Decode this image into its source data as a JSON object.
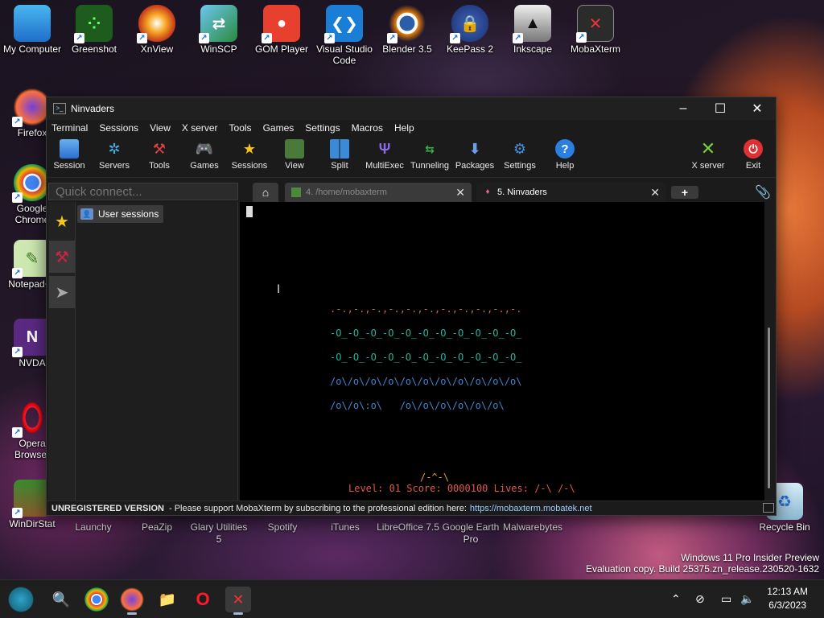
{
  "desktop": {
    "top_icons": [
      "My Computer",
      "Greenshot",
      "XnView",
      "WinSCP",
      "GOM Player",
      "Visual Studio Code",
      "Blender 3.5",
      "KeePass 2",
      "Inkscape",
      "MobaXterm"
    ],
    "left_icons": [
      "Firefox",
      "Google Chrome",
      "Notepad++",
      "NVDA",
      "Opera Browser",
      "WinDirStat"
    ],
    "bottom_icons": [
      "Launchy",
      "PeaZip",
      "Glary Utilities 5",
      "Spotify",
      "iTunes",
      "LibreOffice 7.5",
      "Google Earth Pro",
      "Malwarebytes",
      "Recycle Bin"
    ],
    "watermark": {
      "line1": "Windows 11 Pro Insider Preview",
      "line2": "Evaluation copy. Build 25375.zn_release.230520-1632"
    }
  },
  "window": {
    "title": "Ninvaders",
    "menu": [
      "Terminal",
      "Sessions",
      "View",
      "X server",
      "Tools",
      "Games",
      "Settings",
      "Macros",
      "Help"
    ],
    "toolbar": {
      "session": "Session",
      "servers": "Servers",
      "tools": "Tools",
      "games": "Games",
      "sessions": "Sessions",
      "view": "View",
      "split": "Split",
      "multiexec": "MultiExec",
      "tunneling": "Tunneling",
      "packages": "Packages",
      "settings": "Settings",
      "help": "Help",
      "xserver": "X server",
      "exit": "Exit"
    },
    "quick_connect_placeholder": "Quick connect...",
    "user_sessions": "User sessions",
    "tabs": {
      "tab4": "4. /home/mobaxterm",
      "tab5": "5. Ninvaders"
    },
    "terminal": {
      "shields": ".-.,-.,-.,-.,-.,-.,-.,-.,-.,-.,-.",
      "row1": "-O_-O_-O_-O_-O_-O_-O_-O_-O_-O_-O_",
      "row2": "-O_-O_-O_-O_-O_-O_-O_-O_-O_-O_-O_",
      "row3": "/o\\/o\\/o\\/o\\/o\\/o\\/o\\/o\\/o\\/o\\/o\\",
      "row4": "/o\\/o\\:o\\   /o\\/o\\/o\\/o\\/o\\/o\\",
      "ship": "/-^-\\",
      "status": "Level: 01 Score: 0000100 Lives: /-\\ /-\\"
    },
    "statusbar": {
      "label": "UNREGISTERED VERSION",
      "message": "-  Please support MobaXterm by subscribing to the professional edition here:",
      "url": "https://mobaxterm.mobatek.net"
    }
  },
  "taskbar": {
    "time": "12:13 AM",
    "date": "6/3/2023"
  }
}
